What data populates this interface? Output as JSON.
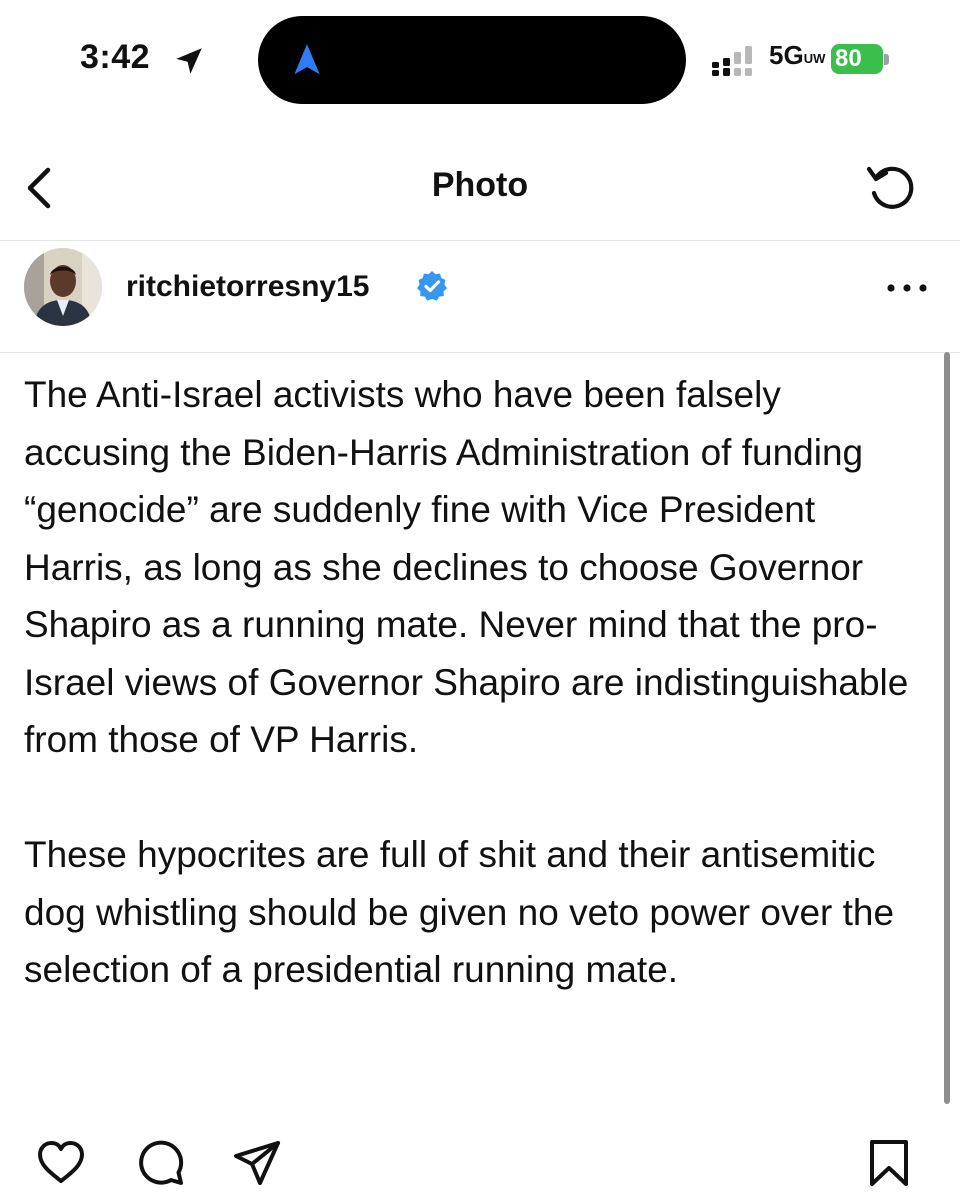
{
  "status_bar": {
    "time": "3:42",
    "network": "5G",
    "network_suffix": "UW",
    "battery": "80",
    "battery_color": "#3bbf4c"
  },
  "nav": {
    "title": "Photo"
  },
  "post": {
    "username": "ritchietorresny15",
    "verified_color": "#3797f0",
    "paragraphs": [
      "The Anti-Israel activists who have been falsely accusing the Biden-Harris Administration of funding “genocide” are suddenly fine with Vice President Harris, as long as she declines to choose Governor Shapiro as a running mate. Never mind that the pro-Israel views of Governor Shapiro are indistinguishable from those of VP Harris.",
      "These hypocrites are full of shit and their antisemitic dog whistling should be given no veto power over the selection of a presidential running mate."
    ]
  },
  "icons": {
    "status": [
      "location-arrow-icon",
      "navigation-arrow-icon",
      "cellular-signal-icon"
    ],
    "nav": [
      "chevron-left-icon",
      "refresh-icon"
    ],
    "header": [
      "verified-badge-icon",
      "more-options-icon"
    ],
    "actions": [
      "heart-icon",
      "comment-icon",
      "share-icon",
      "bookmark-icon"
    ]
  }
}
